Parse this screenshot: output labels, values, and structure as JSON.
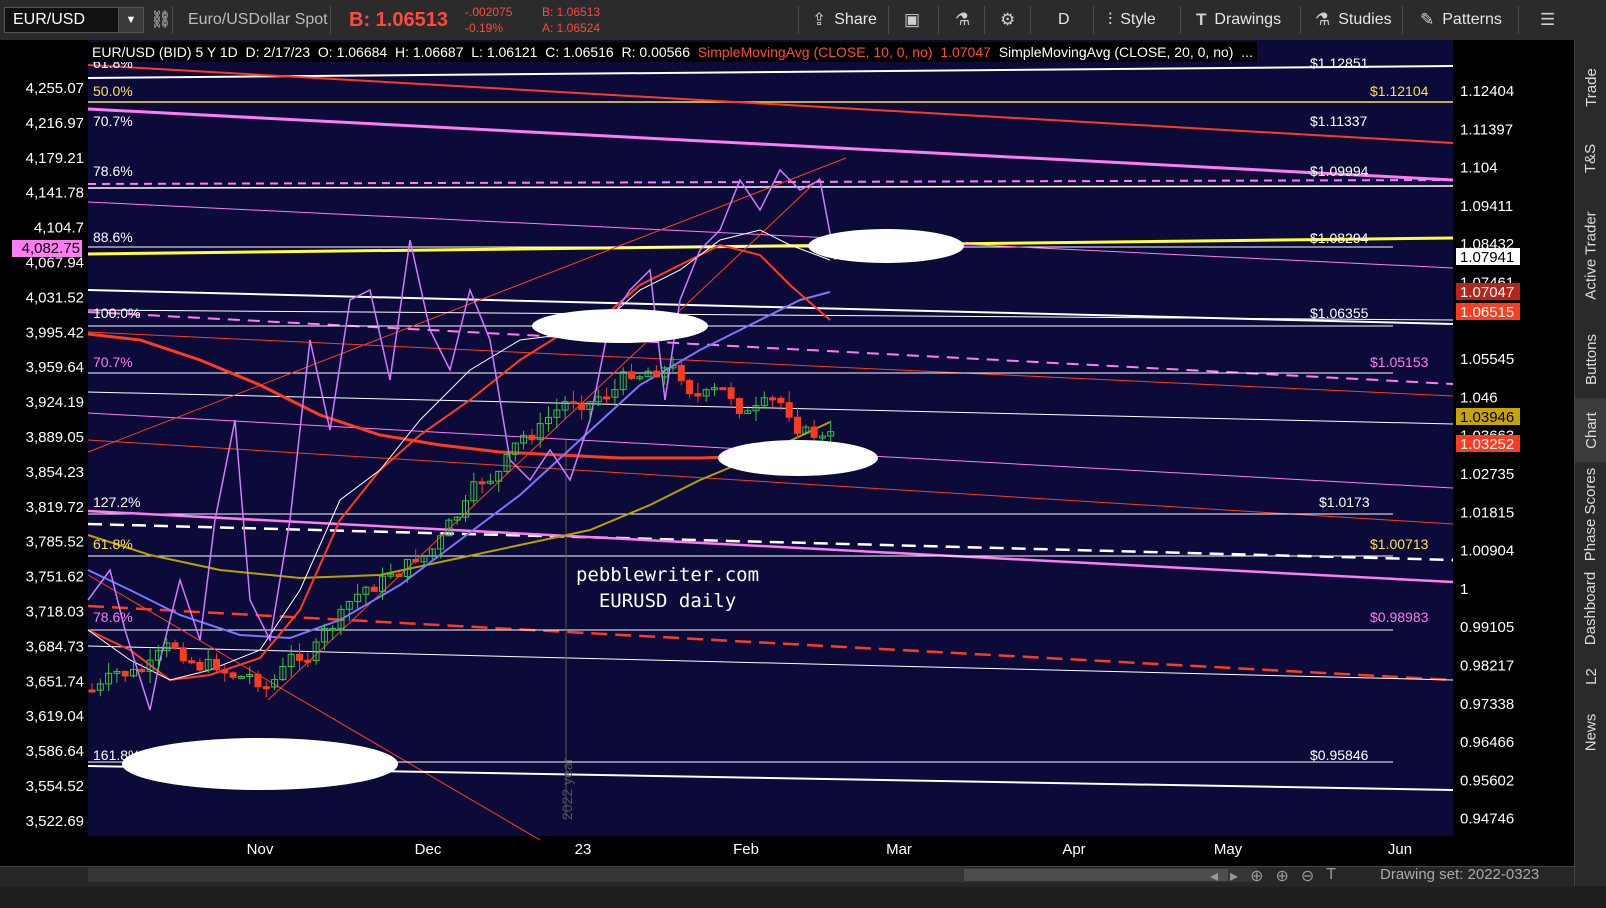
{
  "toolbar": {
    "symbol": "EUR/USD",
    "description": "Euro/USDollar Spot",
    "bid": "B: 1.06513",
    "change": "-.002075",
    "change_pct": "-0.19%",
    "bid_small": "B: 1.06513",
    "ask_small": "A: 1.06524",
    "share": "Share",
    "timeframe": "D",
    "style": "Style",
    "drawings": "Drawings",
    "studies": "Studies",
    "patterns": "Patterns"
  },
  "study_header": {
    "symbol_info": "EUR/USD (BID) 5 Y 1D",
    "date": "D: 2/17/23",
    "open": "O: 1.06684",
    "high": "H: 1.06687",
    "low": "L: 1.06121",
    "close": "C: 1.06516",
    "range": "R: 0.00566",
    "sma10": "SimpleMovingAvg (CLOSE, 10, 0, no)",
    "sma10_val": "1.07047",
    "sma20": "SimpleMovingAvg (CLOSE, 20, 0, no)",
    "more": "..."
  },
  "left_axis": [
    "4,255.07",
    "4,216.97",
    "4,179.21",
    "4,141.78",
    "4,104.7",
    "4,067.94",
    "4,031.52",
    "3,995.42",
    "3,959.64",
    "3,924.19",
    "3,889.05",
    "3,854.23",
    "3,819.72",
    "3,785.52",
    "3,751.62",
    "3,718.03",
    "3,684.73",
    "3,651.74",
    "3,619.04",
    "3,586.64",
    "3,554.52",
    "3,522.69"
  ],
  "left_axis_highlight": "4,082.75",
  "right_axis": [
    "1.12404",
    "1.11397",
    "1.104",
    "1.09411",
    "1.08432",
    "1.07461",
    "1.06498",
    "1.05545",
    "1.046",
    "1.03663",
    "1.02735",
    "1.01815",
    "1.00904",
    "1",
    "0.99105",
    "0.98217",
    "0.97338",
    "0.96466",
    "0.95602",
    "0.94746"
  ],
  "right_badges": [
    {
      "text": "1.07941",
      "bg": "#ffffff",
      "fg": "#000000"
    },
    {
      "text": "1.07047",
      "bg": "#b8231a",
      "fg": "#ffffff"
    },
    {
      "text": "1.06515",
      "bg": "#ff3b1f",
      "fg": "#ffffff"
    },
    {
      "text": "1.03946",
      "bg": "#c9a400",
      "fg": "#000000"
    },
    {
      "text": "1.03252",
      "bg": "#ff3b1f",
      "fg": "#ffffff"
    }
  ],
  "x_axis": [
    "Nov",
    "Dec",
    "23",
    "Feb",
    "Mar",
    "Apr",
    "May",
    "Jun"
  ],
  "fib_labels_left": [
    {
      "text": "61.8%",
      "color": "#ffffff"
    },
    {
      "text": "50.0%",
      "color": "#ffe14a"
    },
    {
      "text": "70.7%",
      "color": "#ffffff"
    },
    {
      "text": "78.6%",
      "color": "#ffffff"
    },
    {
      "text": "88.6%",
      "color": "#ffffff"
    },
    {
      "text": "100.0%",
      "color": "#ffffff"
    },
    {
      "text": "70.7%",
      "color": "#ff7bf2"
    },
    {
      "text": "127.2%",
      "color": "#ffffff"
    },
    {
      "text": "61.8%",
      "color": "#ffe14a"
    },
    {
      "text": "78.6%",
      "color": "#ff7bf2"
    },
    {
      "text": "161.8%",
      "color": "#ffffff"
    }
  ],
  "fib_labels_right": [
    {
      "text": "$1.12851",
      "color": "#ffffff"
    },
    {
      "text": "$1.12104",
      "color": "#ffe14a"
    },
    {
      "text": "$1.11337",
      "color": "#ffffff"
    },
    {
      "text": "$1.09994",
      "color": "#ffffff"
    },
    {
      "text": "$1.08294",
      "color": "#ffffff"
    },
    {
      "text": "$1.06355",
      "color": "#ffffff"
    },
    {
      "text": "$1.05153",
      "color": "#ff7bf2"
    },
    {
      "text": "$1.0173",
      "color": "#ffffff"
    },
    {
      "text": "$1.00713",
      "color": "#ffe14a"
    },
    {
      "text": "$0.98983",
      "color": "#ff7bf2"
    },
    {
      "text": "$0.95846",
      "color": "#ffffff"
    }
  ],
  "watermark": {
    "line1": "pebblewriter.com",
    "line2": "EURUSD daily"
  },
  "year_marker": "2022 year",
  "right_rail_tabs": [
    "Trade",
    "T&S",
    "Active Trader",
    "Buttons",
    "Chart",
    "Phase Scores",
    "Dashboard",
    "L2",
    "News"
  ],
  "footer": {
    "dataset": "Drawing set: 2022-0323"
  }
}
